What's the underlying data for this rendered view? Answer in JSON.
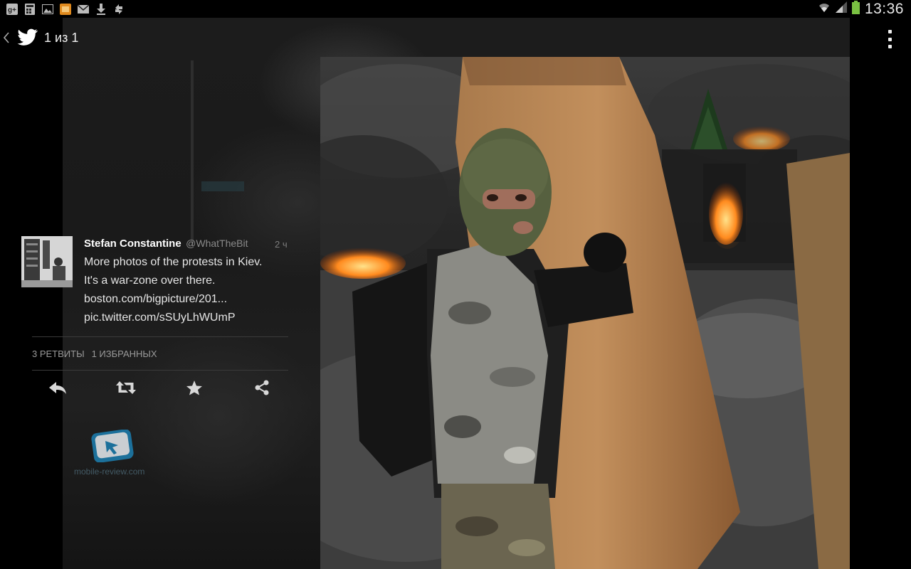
{
  "status_bar": {
    "time": "13:36",
    "left_icons": [
      "google-plus-icon",
      "calculator-icon",
      "image-icon",
      "app-icon",
      "email-icon",
      "download-icon",
      "sync-icon"
    ],
    "right_icons": [
      "wifi-icon",
      "signal-icon",
      "battery-icon"
    ],
    "battery_color": "#7ac142"
  },
  "action_bar": {
    "title": "1 из 1",
    "app_icon": "twitter-bird-icon",
    "back_icon": "chevron-left-icon",
    "menu_icon": "overflow-menu-icon"
  },
  "tweet": {
    "name": "Stefan Constantine",
    "handle": "@WhatTheBit",
    "time": "2 ч",
    "lines": [
      "More photos of the protests in Kiev.",
      "It's a war-zone over there.",
      "boston.com/bigpicture/201...",
      "pic.twitter.com/sSUyLhWUmP"
    ],
    "retweets": "3 РЕТВИТЫ",
    "favorites": "1 ИЗБРАННЫХ"
  },
  "actions": [
    "reply-icon",
    "retweet-icon",
    "favorite-star-icon",
    "share-icon"
  ],
  "watermark": {
    "text": "mobile-review.com"
  }
}
